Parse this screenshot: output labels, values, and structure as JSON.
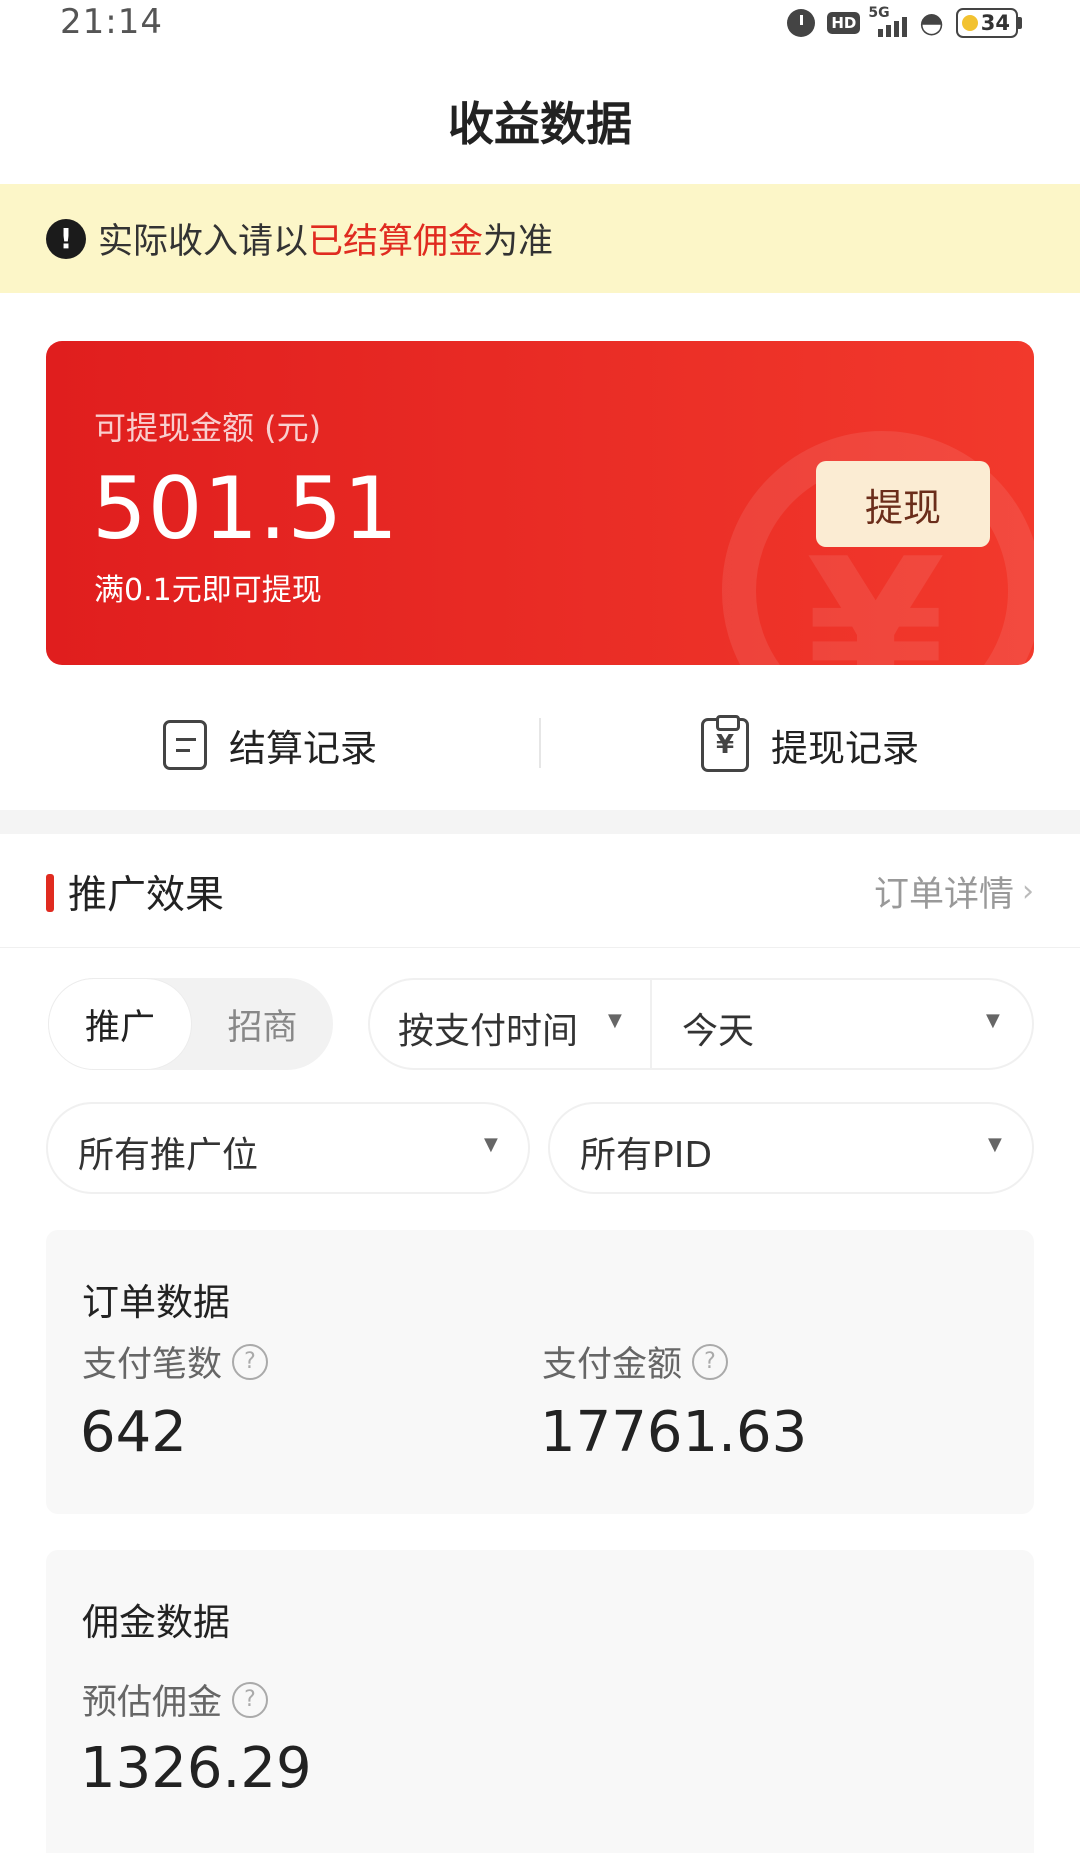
{
  "status_bar": {
    "time": "21:14",
    "network": "5G",
    "hd": "HD",
    "battery": "34"
  },
  "header": {
    "title": "收益数据"
  },
  "notice": {
    "prefix": "实际收入请以",
    "highlight": "已结算佣金",
    "suffix": "为准"
  },
  "balance": {
    "label": "可提现金额 (元)",
    "amount": "501.51",
    "note": "满0.1元即可提现",
    "withdraw_label": "提现"
  },
  "records": {
    "settlement_label": "结算记录",
    "withdraw_label": "提现记录"
  },
  "promo_section": {
    "title": "推广效果",
    "link_label": "订单详情"
  },
  "filters": {
    "segment_active": "推广",
    "segment_inactive": "招商",
    "time_type": "按支付时间",
    "period": "今天",
    "position": "所有推广位",
    "pid": "所有PID"
  },
  "order_data": {
    "title": "订单数据",
    "pay_count_label": "支付笔数",
    "pay_count_value": "642",
    "pay_amount_label": "支付金额",
    "pay_amount_value": "17761.63"
  },
  "commission_data": {
    "title": "佣金数据",
    "estimated_label": "预估佣金",
    "estimated_value": "1326.29"
  },
  "colors": {
    "accent_red": "#e02b20",
    "notice_bg": "#fcf6c8",
    "button_bg": "#fbecd3"
  }
}
